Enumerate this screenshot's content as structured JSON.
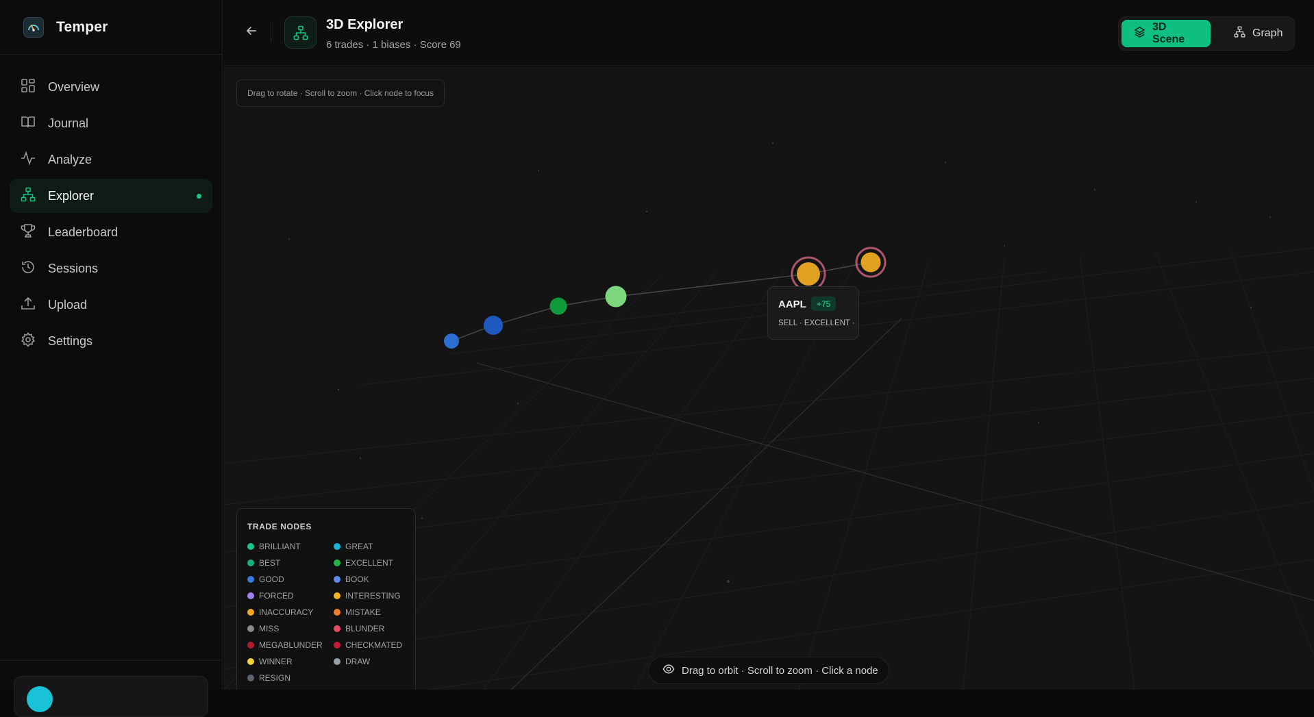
{
  "app": {
    "name": "Temper"
  },
  "sidebar": {
    "items": [
      {
        "label": "Overview",
        "icon": "grid-icon"
      },
      {
        "label": "Journal",
        "icon": "book-icon"
      },
      {
        "label": "Analyze",
        "icon": "pulse-icon"
      },
      {
        "label": "Explorer",
        "icon": "network-icon",
        "active": true
      },
      {
        "label": "Leaderboard",
        "icon": "trophy-icon"
      },
      {
        "label": "Sessions",
        "icon": "history-icon"
      },
      {
        "label": "Upload",
        "icon": "upload-icon"
      },
      {
        "label": "Settings",
        "icon": "gear-icon"
      }
    ]
  },
  "header": {
    "title": "3D Explorer",
    "subtitle": "6 trades · 1 biases · Score 69",
    "view_toggle": {
      "scene_label": "3D Scene",
      "graph_label": "Graph",
      "selected": "3D Scene"
    }
  },
  "scene": {
    "hint_top": "Drag to rotate · Scroll to zoom · Click node to focus",
    "hint_bottom": "Drag to orbit · Scroll to zoom · Click a node",
    "tooltip": {
      "ticker": "AAPL",
      "badge": "+75",
      "meta": "SELL · EXCELLENT ·"
    }
  },
  "legend": {
    "title": "TRADE NODES",
    "items": [
      {
        "label": "BRILLIANT",
        "color": "#19c48c"
      },
      {
        "label": "GREAT",
        "color": "#1bb3d9"
      },
      {
        "label": "BEST",
        "color": "#14b07a"
      },
      {
        "label": "EXCELLENT",
        "color": "#22b34a"
      },
      {
        "label": "GOOD",
        "color": "#3b78e0"
      },
      {
        "label": "BOOK",
        "color": "#5b8ee6"
      },
      {
        "label": "FORCED",
        "color": "#a27ff0"
      },
      {
        "label": "INTERESTING",
        "color": "#f0b429"
      },
      {
        "label": "INACCURACY",
        "color": "#f4a523"
      },
      {
        "label": "MISTAKE",
        "color": "#f07e2a"
      },
      {
        "label": "MISS",
        "color": "#8a8a8a"
      },
      {
        "label": "BLUNDER",
        "color": "#e84a6a"
      },
      {
        "label": "MEGABLUNDER",
        "color": "#b01e2e"
      },
      {
        "label": "CHECKMATED",
        "color": "#c21a3c"
      },
      {
        "label": "WINNER",
        "color": "#f5d33a"
      },
      {
        "label": "DRAW",
        "color": "#9aa0a8"
      },
      {
        "label": "RESIGN",
        "color": "#5b6470"
      }
    ]
  },
  "colors": {
    "accent": "#0fbf80",
    "node_good": "#1f62c8",
    "node_excellent": "#0f9a3c",
    "node_selected": "#7dd67e",
    "node_inaccuracy": "#e0a020",
    "bias_ring": "#c5607a"
  }
}
